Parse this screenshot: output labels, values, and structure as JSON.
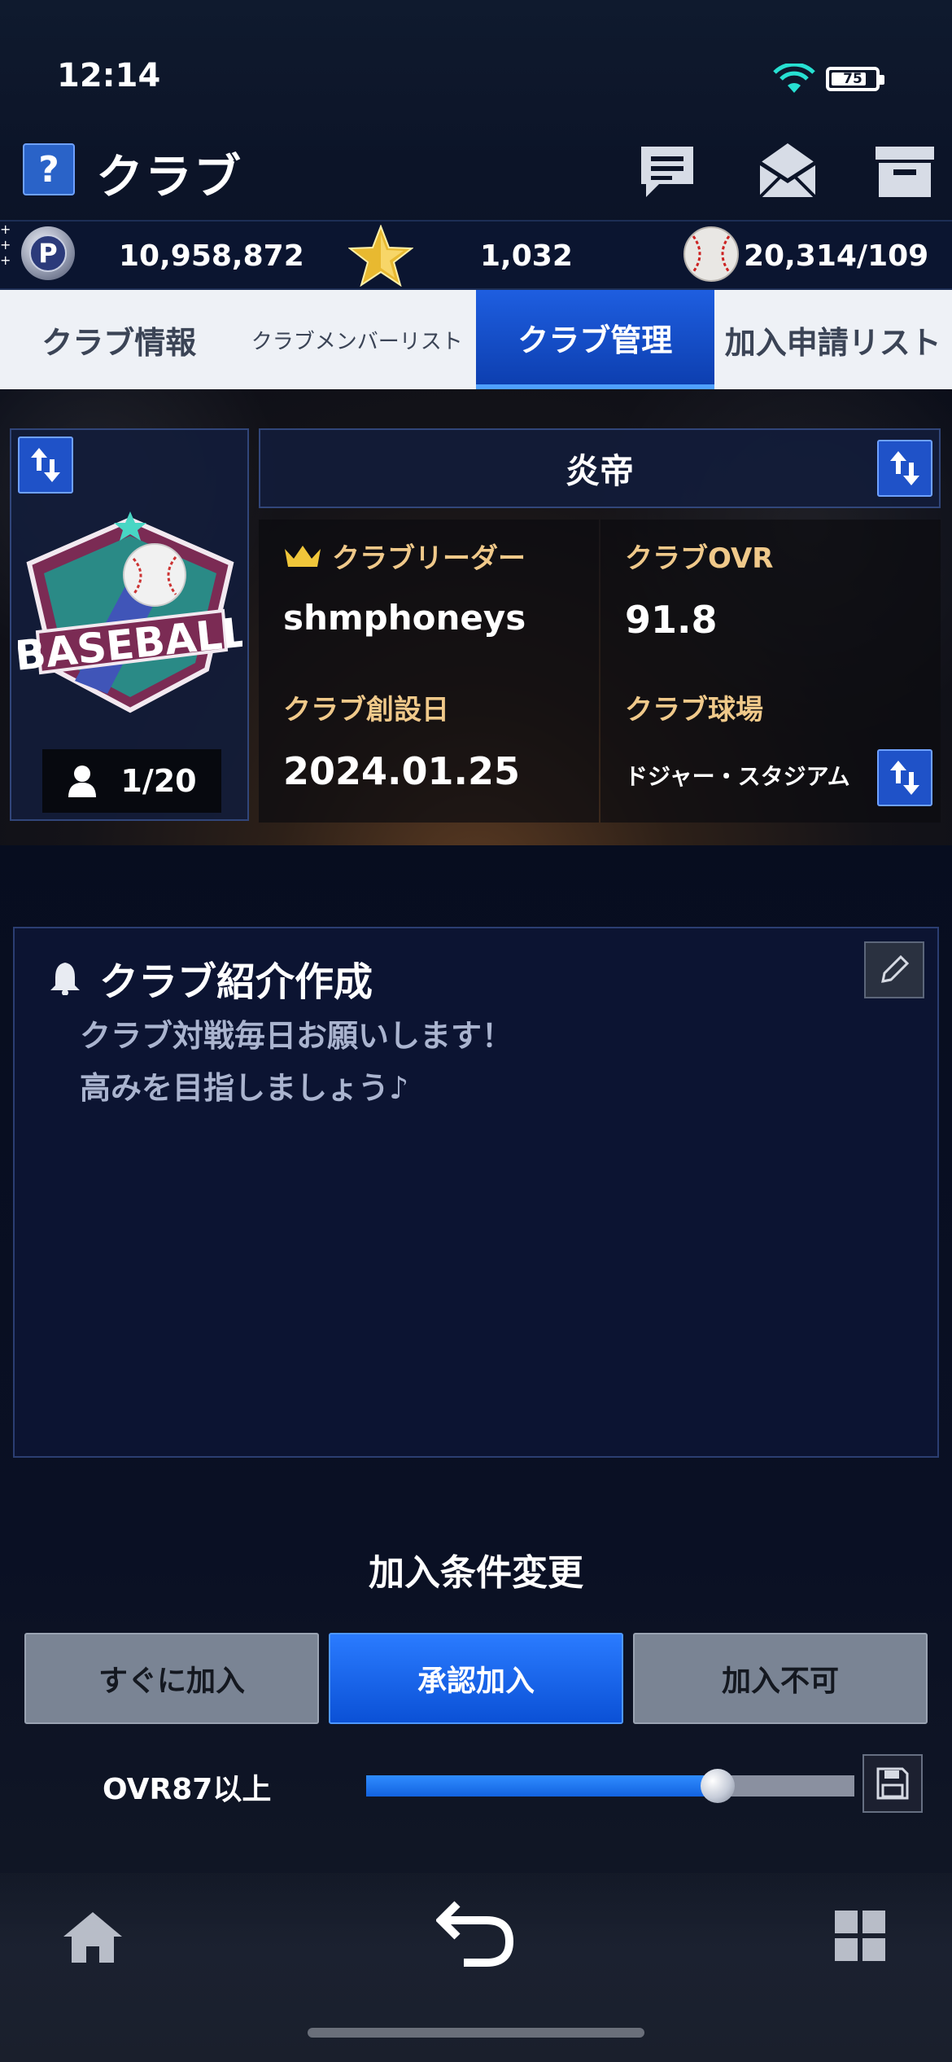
{
  "status_bar": {
    "time": "12:14",
    "battery": "75"
  },
  "header": {
    "help_label": "?",
    "title": "クラブ"
  },
  "currency": {
    "points": "10,958,872",
    "stars": "1,032",
    "balls": "20,314/109",
    "plus_label": "+"
  },
  "tabs": [
    {
      "label": "クラブ情報",
      "active": false
    },
    {
      "label": "クラブメンバーリスト",
      "active": false
    },
    {
      "label": "クラブ管理",
      "active": true
    },
    {
      "label": "加入申請リスト",
      "active": false
    }
  ],
  "club": {
    "name": "炎帝",
    "emblem_text": "BASEBALL",
    "member_count": "1/20",
    "leader_label": "クラブリーダー",
    "leader_value": "shmphoneys",
    "ovr_label": "クラブOVR",
    "ovr_value": "91.8",
    "founded_label": "クラブ創設日",
    "founded_value": "2024.01.25",
    "stadium_label": "クラブ球場",
    "stadium_value": "ドジャー・スタジアム"
  },
  "intro": {
    "title": "クラブ紹介作成",
    "lines": [
      "クラブ対戦毎日お願いします！",
      "高みを目指しましょう♪"
    ]
  },
  "join_conditions": {
    "title": "加入条件変更",
    "options": [
      {
        "label": "すぐに加入",
        "active": false
      },
      {
        "label": "承認加入",
        "active": true
      },
      {
        "label": "加入不可",
        "active": false
      }
    ],
    "ovr_label": "OVR87以上",
    "ovr_slider_fraction": 0.72
  },
  "colors": {
    "accent_blue": "#1e5ee0",
    "label_gold": "#f0c98a",
    "panel_bg": "#0c1432"
  }
}
